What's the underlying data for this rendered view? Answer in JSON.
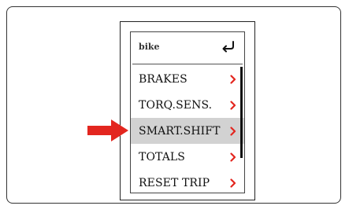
{
  "screen": {
    "title": "bike",
    "back_icon": "return-arrow-icon"
  },
  "menu": {
    "items": [
      {
        "label": "BRAKES",
        "icon": "chevron-right-icon",
        "selected": false
      },
      {
        "label": "TORQ.SENS.",
        "icon": "chevron-right-icon",
        "selected": false
      },
      {
        "label": "SMART.SHIFT",
        "icon": "chevron-right-icon",
        "selected": true
      },
      {
        "label": "TOTALS",
        "icon": "chevron-right-icon",
        "selected": false
      },
      {
        "label": "RESET TRIP",
        "icon": "chevron-right-icon",
        "selected": false
      }
    ]
  },
  "annotation": {
    "pointer_icon": "red-arrow-icon",
    "color": "#e3261f"
  },
  "colors": {
    "chevron": "#e3261f",
    "selected_row": "#d2d2d2",
    "border": "#333333"
  }
}
